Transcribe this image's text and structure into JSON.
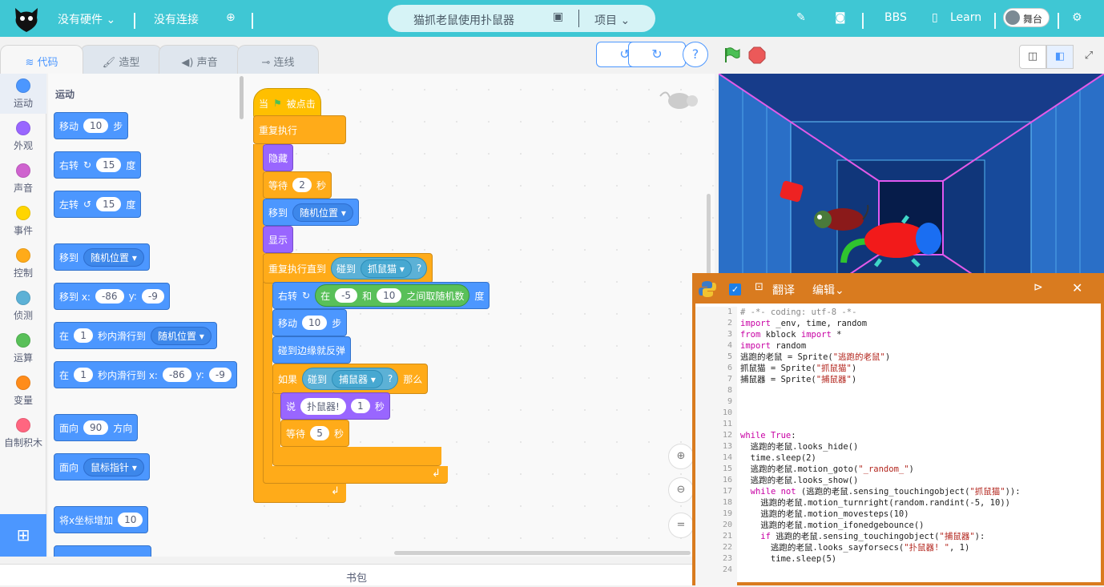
{
  "topbar": {
    "hardware": "没有硬件",
    "connection": "没有连接",
    "project_title": "猫抓老鼠使用扑鼠器",
    "project_menu": "项目",
    "bbs": "BBS",
    "learn": "Learn",
    "stage_toggle": "舞台"
  },
  "tabs": {
    "code": "代码",
    "costume": "造型",
    "sound": "声音",
    "wiring": "连线"
  },
  "categories": [
    {
      "label": "运动",
      "color": "#4c97ff"
    },
    {
      "label": "外观",
      "color": "#9966ff"
    },
    {
      "label": "声音",
      "color": "#cf63cf"
    },
    {
      "label": "事件",
      "color": "#ffd500"
    },
    {
      "label": "控制",
      "color": "#ffab19"
    },
    {
      "label": "侦测",
      "color": "#5cb1d6"
    },
    {
      "label": "运算",
      "color": "#59c059"
    },
    {
      "label": "变量",
      "color": "#ff8c1a"
    },
    {
      "label": "自制积木",
      "color": "#ff6680"
    }
  ],
  "palette": {
    "section": "运动",
    "move": {
      "a": "移动",
      "v": "10",
      "b": "步"
    },
    "turn_right": {
      "a": "右转",
      "v": "15",
      "b": "度"
    },
    "turn_left": {
      "a": "左转",
      "v": "15",
      "b": "度"
    },
    "goto": {
      "a": "移到",
      "dd": "随机位置"
    },
    "goto_xy": {
      "a": "移到 x:",
      "x": "-86",
      "yl": "y:",
      "y": "-9"
    },
    "glide": {
      "a": "在",
      "v": "1",
      "b": "秒内滑行到",
      "dd": "随机位置"
    },
    "glide_xy": {
      "a": "在",
      "v": "1",
      "b": "秒内滑行到 x:",
      "x": "-86",
      "yl": "y:",
      "y": "-9"
    },
    "point": {
      "a": "面向",
      "v": "90",
      "b": "方向"
    },
    "point_towards": {
      "a": "面向",
      "dd": "鼠标指针"
    },
    "change_x": {
      "a": "将x坐标增加",
      "v": "10"
    }
  },
  "script": {
    "when_flag": {
      "a": "当",
      "b": "被点击"
    },
    "forever": "重复执行",
    "hide": "隐藏",
    "wait1": {
      "a": "等待",
      "v": "2",
      "b": "秒"
    },
    "goto": {
      "a": "移到",
      "dd": "随机位置"
    },
    "show": "显示",
    "repeat_until": "重复执行直到",
    "touching1": {
      "a": "碰到",
      "dd": "抓鼠猫",
      "q": "?"
    },
    "turn": {
      "a": "右转",
      "in": "在",
      "v1": "-5",
      "and": "和",
      "v2": "10",
      "b": "之间取随机数",
      "c": "度"
    },
    "move": {
      "a": "移动",
      "v": "10",
      "b": "步"
    },
    "bounce": "碰到边缘就反弹",
    "if": {
      "a": "如果",
      "then": "那么"
    },
    "touching2": {
      "a": "碰到",
      "dd": "捕鼠器",
      "q": "?"
    },
    "say": {
      "a": "说",
      "msg": "扑鼠器!",
      "v": "1",
      "b": "秒"
    },
    "wait2": {
      "a": "等待",
      "v": "5",
      "b": "秒"
    }
  },
  "editor": {
    "translate": "翻译",
    "edit": "编辑",
    "code_lines": [
      "# -*- coding: utf-8 -*-",
      "import _env, time, random",
      "from kblock import *",
      "import random",
      "逃跑的老鼠 = Sprite(\"逃跑的老鼠\")",
      "抓鼠猫 = Sprite(\"抓鼠猫\")",
      "捕鼠器 = Sprite(\"捕鼠器\")",
      "",
      "",
      "",
      "",
      "while True:",
      "  逃跑的老鼠.looks_hide()",
      "  time.sleep(2)",
      "  逃跑的老鼠.motion_goto(\"_random_\")",
      "  逃跑的老鼠.looks_show()",
      "  while not (逃跑的老鼠.sensing_touchingobject(\"抓鼠猫\")):",
      "    逃跑的老鼠.motion_turnright(random.randint(-5, 10))",
      "    逃跑的老鼠.motion_movesteps(10)",
      "    逃跑的老鼠.motion_ifonedgebounce()",
      "    if 逃跑的老鼠.sensing_touchingobject(\"捕鼠器\"):",
      "      逃跑的老鼠.looks_sayforsecs(\"扑鼠器! \", 1)",
      "      time.sleep(5)",
      ""
    ],
    "line_numbers": [
      "1",
      "2",
      "3",
      "4",
      "5",
      "6",
      "7",
      "8",
      "9",
      "10",
      "11",
      "12",
      "13",
      "14",
      "15",
      "16",
      "17",
      "18",
      "19",
      "20",
      "21",
      "22",
      "23",
      "24"
    ]
  },
  "bottom": {
    "backpack": "书包"
  }
}
